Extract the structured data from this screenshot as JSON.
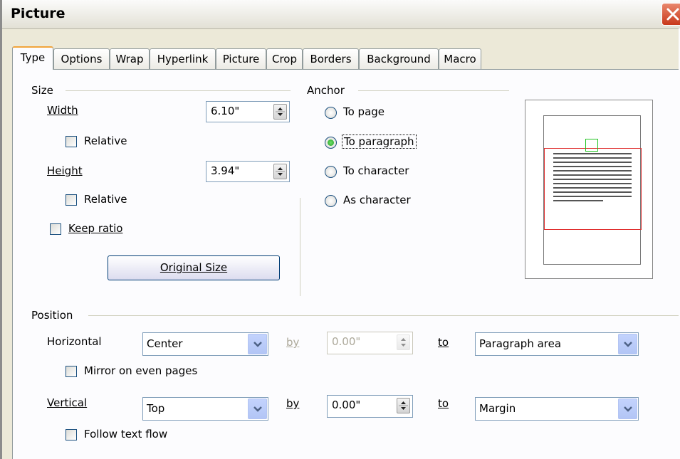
{
  "window": {
    "title": "Picture"
  },
  "tabs": [
    {
      "label": "Type",
      "active": true
    },
    {
      "label": "Options"
    },
    {
      "label": "Wrap"
    },
    {
      "label": "Hyperlink"
    },
    {
      "label": "Picture"
    },
    {
      "label": "Crop"
    },
    {
      "label": "Borders"
    },
    {
      "label": "Background"
    },
    {
      "label": "Macro"
    }
  ],
  "size": {
    "section_label": "Size",
    "width_label": "Width",
    "width_value": "6.10\"",
    "width_relative_label": "Relative",
    "width_relative_checked": false,
    "height_label": "Height",
    "height_value": "3.94\"",
    "height_relative_label": "Relative",
    "height_relative_checked": false,
    "keep_ratio_label": "Keep ratio",
    "keep_ratio_checked": false,
    "original_size_label": "Original Size"
  },
  "anchor": {
    "section_label": "Anchor",
    "options": [
      {
        "label": "To page",
        "selected": false
      },
      {
        "label": "To paragraph",
        "selected": true
      },
      {
        "label": "To character",
        "selected": false
      },
      {
        "label": "As character",
        "selected": false
      }
    ]
  },
  "position": {
    "section_label": "Position",
    "horizontal_label": "Horizontal",
    "horizontal_value": "Center",
    "horizontal_by_label": "by",
    "horizontal_by_value": "0.00\"",
    "horizontal_to_label": "to",
    "horizontal_to_value": "Paragraph area",
    "mirror_label": "Mirror on even pages",
    "mirror_checked": false,
    "vertical_label": "Vertical",
    "vertical_value": "Top",
    "vertical_by_label": "by",
    "vertical_by_value": "0.00\"",
    "vertical_to_label": "to",
    "vertical_to_value": "Margin",
    "follow_label": "Follow text flow",
    "follow_checked": false
  },
  "icons": {
    "close": "close-icon",
    "spin": "spin-arrows-icon",
    "dropdown": "chevron-down-icon"
  },
  "colors": {
    "active_tab_accent": "#f1a43b",
    "close_button": "#c8381b",
    "preview_paragraph_border": "#e03030",
    "preview_anchor": "#22c422",
    "radio_dot": "#21a121"
  }
}
